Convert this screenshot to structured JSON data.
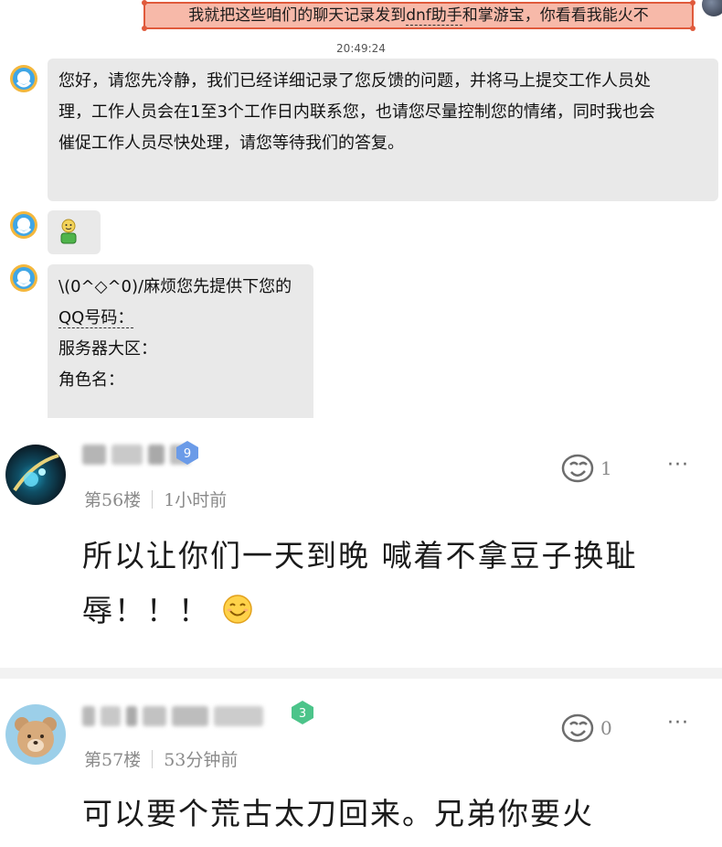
{
  "chat": {
    "outgoing_message_prefix": "我就把这些咱们的聊天记录发到",
    "outgoing_message_highlight": "dnf助手",
    "outgoing_message_suffix": "和掌游宝，你看看我能火不",
    "timestamp": "20:49:24",
    "reply_1_line_1": "您好，请您先冷静，我们已经详细记录了您反馈的问题，并将马上提交工作人员处",
    "reply_1_line_2": "理，工作人员会在1至3个工作日内联系您，也请您尽量控制您的情绪，同时我也会",
    "reply_1_line_3": "催促工作人员尽快处理，请您等待我们的答复。",
    "reply_3_line_1": "\\(0^◇^0)/麻烦您先提供下您的",
    "reply_3_line_2": "QQ号码：",
    "reply_3_line_3": "服务器大区：",
    "reply_3_line_4": "角色名："
  },
  "comments": [
    {
      "level": "9",
      "floor": "第56楼",
      "time": "1小时前",
      "likes": "1",
      "more": "···",
      "text_line_1": "所以让你们一天到晚 喊着不拿豆子换耻",
      "text_line_2": "辱！！！"
    },
    {
      "level": "3",
      "floor": "第57楼",
      "time": "53分钟前",
      "likes": "0",
      "more": "···",
      "text_line_1": "可以要个荒古太刀回来。兄弟你要火"
    }
  ],
  "colors": {
    "outgoing_bubble": "#f7b9a9",
    "outgoing_border": "#e05a3c",
    "incoming_bubble": "#e9e9e9",
    "meta_text": "#8a8a8a",
    "badge_blue": "#6b9be8",
    "badge_green": "#4cc48a"
  },
  "icons": [
    "qq-service-icon",
    "cartoon-man-emoji-icon",
    "smile-emoji-icon",
    "like-icon",
    "more-icon",
    "level-badge-icon"
  ]
}
